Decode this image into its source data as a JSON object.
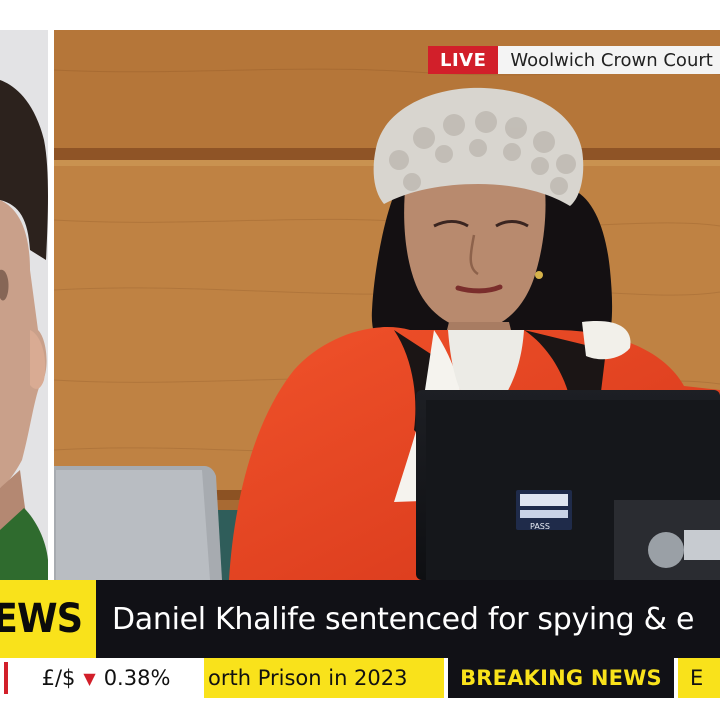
{
  "broadcast": {
    "live_label": "LIVE",
    "location": "Woolwich Crown Court"
  },
  "lower_third": {
    "brand_fragment": "EWS",
    "headline": "Daniel Khalife sentenced for spying & e"
  },
  "ticker": {
    "market_pair": "£/$",
    "market_direction": "down",
    "market_change": "0.38%",
    "scrolling_text": "orth Prison in 2023",
    "breaking_label": "BREAKING NEWS",
    "next_fragment": "E"
  },
  "colors": {
    "brand_yellow": "#f9e21b",
    "live_red": "#d21f2a",
    "banner_black": "#111116",
    "judge_robe_red": "#e8401c"
  },
  "monitor_labels": {
    "sticker_top": "",
    "sticker_bottom": "PASS"
  }
}
